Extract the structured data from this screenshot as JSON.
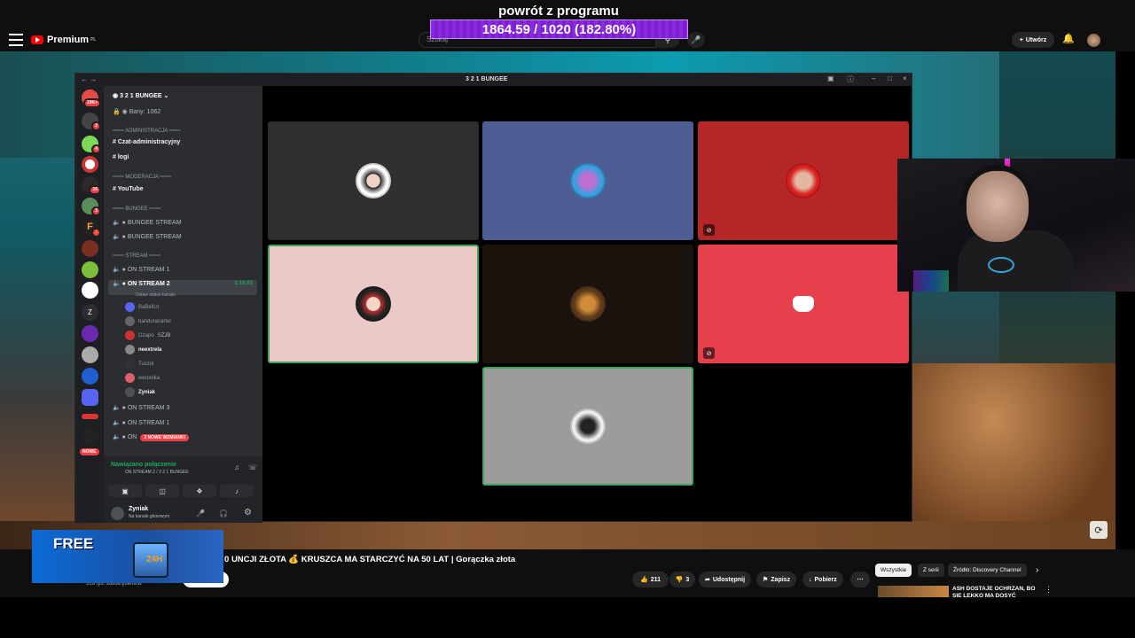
{
  "overlay": {
    "title": "powrót z programu",
    "progress_text": "1864.59 / 1020 (182.80%)",
    "progress_percent": 182.8,
    "bar_color": "#8a2be2"
  },
  "youtube": {
    "logo": "Premium",
    "logo_sup": "PL",
    "search_placeholder": "Szukaj",
    "create_label": "Utwórz",
    "video_title": "UNCJI ZŁOTA 💰 KRUSZCA MA STARCZYĆ NA 50 LAT | Gorączka złota",
    "title_prefix": "0",
    "subscribers": "319 tys. subskrybentów",
    "actions": {
      "likes": "211",
      "dislikes": "3",
      "share": "Udostępnij",
      "save": "Zapisz",
      "download": "Pobierz"
    },
    "chips": [
      "Wszystkie",
      "Z serii",
      "Źródło: Discovery Channel"
    ],
    "rec_title": "ASH DOSTAJE OCHRZAN, BO SIĘ LEKKO MA DOSYĆ"
  },
  "ad": {
    "free_text": "FREE",
    "box_text": "24H"
  },
  "discord": {
    "window_title": "3 2 1 BUNGEE",
    "server_name": "3 2 1 BUNGEE",
    "bany": "Bany: 1062",
    "categories": {
      "admin": "ADMINISTRACJA",
      "moderacja": "MODERACJA",
      "bungee": "BUNGEE",
      "stream": "STREAM"
    },
    "channels": {
      "czat": "Czat-administracyjny",
      "logi": "logi",
      "youtube": "YouTube",
      "bungee1": "BUNGEE STREAM",
      "bungee2": "BUNGEE STREAM",
      "onstream1": "ON STREAM 1",
      "onstream2": "ON STREAM 2",
      "onstream2_time": "2:18:03",
      "onstream2_sub": "Ustaw status kanału",
      "onstream3": "ON STREAM 3",
      "onstream1b": "ON STREAM 1",
      "onstream_last": "ON",
      "mentions": "3 NOWE WZMIANKI"
    },
    "users": [
      "BaBeliUr",
      "banduracartel",
      "Gzapo",
      "neextrela",
      "Tuszol",
      "weronika",
      "Zyniak"
    ],
    "users_extra": "SZJB",
    "server_badges": [
      "19K+",
      "2",
      "4",
      "16",
      "3",
      "1"
    ],
    "nowe": "NOWE",
    "voice": {
      "status": "Nawiązano połączenie",
      "channel": "ON STREAM 2 / 3 2 1 BUNGEE"
    },
    "me": {
      "name": "Zyniak",
      "status": "Na kanale głosowym"
    }
  }
}
